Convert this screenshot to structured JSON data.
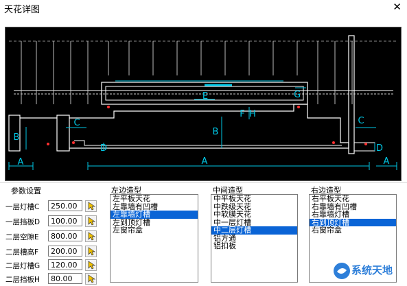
{
  "window": {
    "title": "天花详图"
  },
  "params": {
    "group_label": "参数设置",
    "rows": [
      {
        "label": "一层灯槽C",
        "value": "250.00"
      },
      {
        "label": "一层挡板D",
        "value": "100.00"
      },
      {
        "label": "二层空隙E",
        "value": "800.00"
      },
      {
        "label": "二层槽高F",
        "value": "200.00"
      },
      {
        "label": "二层灯槽G",
        "value": "120.00"
      },
      {
        "label": "二层挡板H",
        "value": "80.00"
      }
    ]
  },
  "left_style": {
    "label": "左边造型",
    "items": [
      "左平板天花",
      "左靠墙有凹槽",
      "左靠墙灯槽",
      "左到顶灯槽",
      "左窗帘盒"
    ],
    "selected": "左靠墙灯槽"
  },
  "middle_style": {
    "label": "中间造型",
    "items": [
      "中平板天花",
      "中跌级天花",
      "中软膜天花",
      "中一层灯槽",
      "中二层灯槽",
      "铝方通",
      "铝扣板"
    ],
    "selected": "中二层灯槽"
  },
  "right_style": {
    "label": "右边造型",
    "items": [
      "右平板天花",
      "右靠墙有凹槽",
      "右靠墙灯槽",
      "右到顶灯槽",
      "右窗帘盒"
    ],
    "selected": "右到顶灯槽"
  },
  "drawing": {
    "dim_labels": [
      "A",
      "B",
      "C",
      "D",
      "E",
      "F",
      "G",
      "H"
    ],
    "line_color": "#00c8e6",
    "structure_color": "#ffffff",
    "marker_color": "#ff3030"
  },
  "watermark": {
    "text": "系统天地"
  }
}
